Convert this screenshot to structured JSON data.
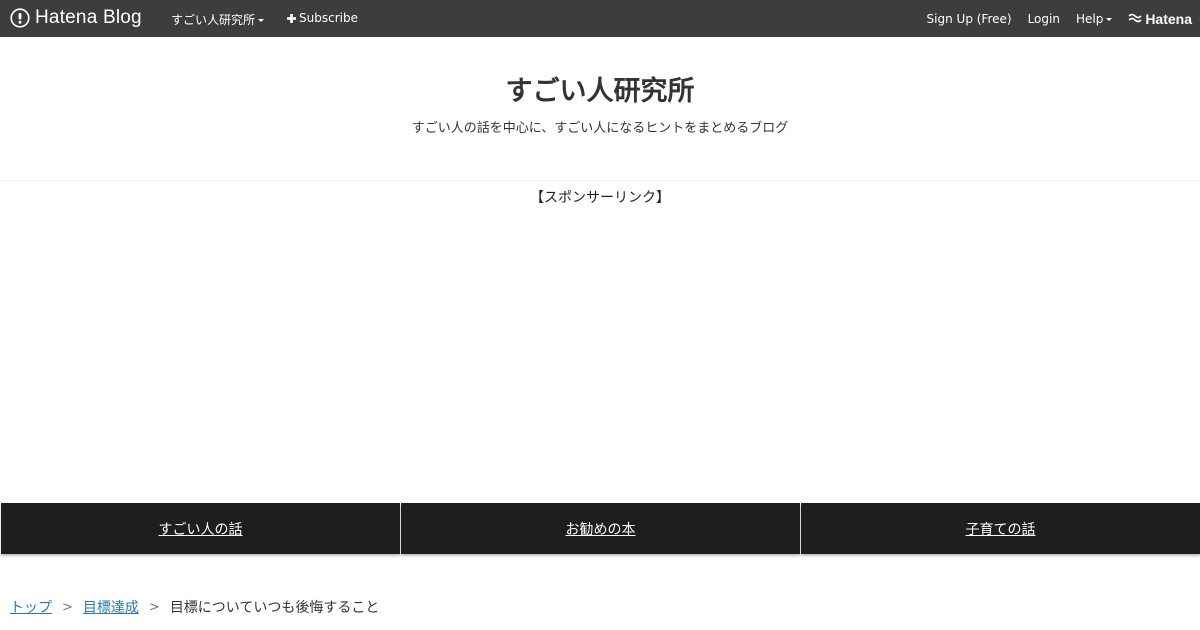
{
  "topbar": {
    "logo_text": "Hatena Blog",
    "blog_menu_label": "すごい人研究所",
    "subscribe_label": "Subscribe",
    "signup_label": "Sign Up (Free)",
    "login_label": "Login",
    "help_label": "Help",
    "hatena_label": "Hatena",
    "background_color": "#3d3d3d"
  },
  "header": {
    "title": "すごい人研究所",
    "description": "すごい人の話を中心に、すごい人になるヒントをまとめるブログ"
  },
  "sponsor": {
    "label": "【スポンサーリンク】"
  },
  "category_nav": {
    "items": [
      {
        "label": "すごい人の話"
      },
      {
        "label": "お勧めの本"
      },
      {
        "label": "子育ての話"
      }
    ],
    "background_color": "#1e1e1e"
  },
  "breadcrumb": {
    "items": [
      {
        "label": "トップ"
      },
      {
        "label": "目標達成"
      },
      {
        "label": "目標についていつも後悔すること"
      }
    ],
    "separator": ">",
    "link_color": "#2a7ab0"
  }
}
